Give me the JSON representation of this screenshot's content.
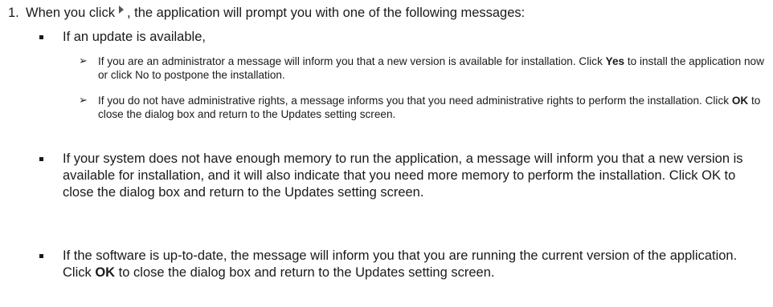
{
  "step": {
    "number": "1.",
    "text_before_icon": "When you click",
    "icon": "play-arrow-icon",
    "text_after_icon": ", the application will prompt you with one of the following messages:"
  },
  "items": {
    "update_available": {
      "text": "If an update is available,",
      "sub": [
        {
          "part1": "If you are an administrator a message will inform you that a new version is available for installation. Click ",
          "bold": "Yes",
          "part2": " to install the application now or click No to postpone the installation."
        },
        {
          "part1": "If you do not have administrative rights, a message informs you that you need administrative rights to perform the installation. Click ",
          "bold": "OK",
          "part2": " to close the dialog box and return to the Updates setting screen."
        }
      ]
    },
    "memory": {
      "text": "If your system does not have enough memory to run the application, a message will inform you that a new version is available for installation, and it will also indicate that you need more memory to perform the installation. Click OK to close the dialog box and return to the Updates setting screen."
    },
    "up_to_date": {
      "part1": "If the software is up-to-date, the message will inform you that you are running the current version of the application. Click ",
      "bold": "OK",
      "part2": " to close the dialog box and return to the Updates setting screen."
    }
  }
}
